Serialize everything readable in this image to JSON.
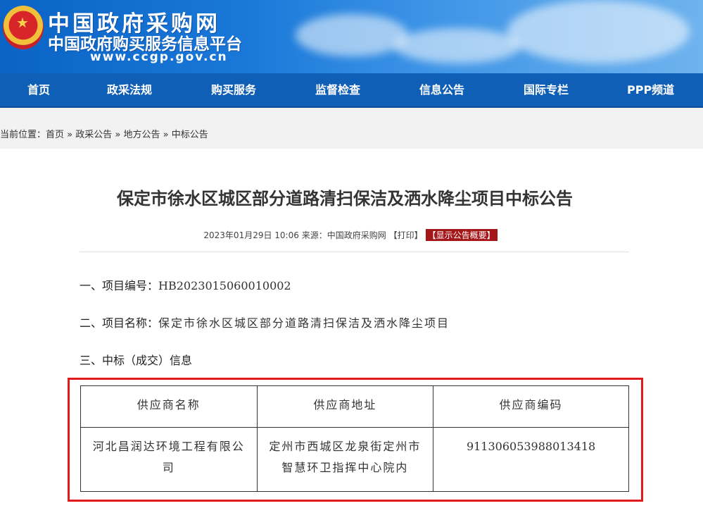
{
  "header": {
    "title": "中国政府采购网",
    "subtitle": "中国政府购买服务信息平台",
    "url": "www.ccgp.gov.cn"
  },
  "nav": {
    "items": [
      "首页",
      "政采法规",
      "购买服务",
      "监督检查",
      "信息公告",
      "国际专栏",
      "PPP频道"
    ]
  },
  "breadcrumb": {
    "prefix": "当前位置：",
    "items": [
      "首页",
      "政采公告",
      "地方公告",
      "中标公告"
    ],
    "separator": "»"
  },
  "article": {
    "title": "保定市徐水区城区部分道路清扫保洁及洒水降尘项目中标公告",
    "date": "2023年01月29日 10:06",
    "source_label": "来源：",
    "source": "中国政府采购网",
    "print_label": "【打印】",
    "summary_label": "【显示公告概要】"
  },
  "sections": {
    "s1_label": "一、项目编号：",
    "s1_value": "HB2023015060010002",
    "s2_label": "二、项目名称：",
    "s2_value": "保定市徐水区城区部分道路清扫保洁及洒水降尘项目",
    "s3_label": "三、中标（成交）信息"
  },
  "table": {
    "headers": [
      "供应商名称",
      "供应商地址",
      "供应商编码"
    ],
    "rows": [
      [
        "河北昌润达环境工程有限公司",
        "定州市西城区龙泉街定州市智慧环卫指挥中心院内",
        "911306053988013418"
      ]
    ]
  },
  "colors": {
    "nav_bg": "#0f5fb6",
    "highlight_frame": "#e01a1a",
    "summary_tag": "#a4161a"
  }
}
